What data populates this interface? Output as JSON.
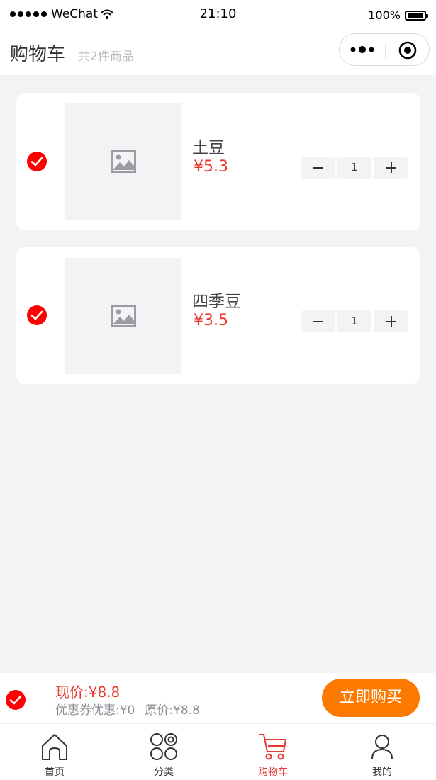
{
  "status_bar": {
    "carrier": "WeChat",
    "time": "21:10",
    "battery": "100%"
  },
  "header": {
    "title": "购物车",
    "subtitle": "共2件商品"
  },
  "capsule": {
    "more_icon": "more-dots-icon",
    "close_icon": "target-icon"
  },
  "items": [
    {
      "name": "土豆",
      "price": "¥5.3",
      "quantity": "1",
      "checked": true
    },
    {
      "name": "四季豆",
      "price": "¥3.5",
      "quantity": "1",
      "checked": true
    }
  ],
  "checkout": {
    "now_price": "现价:¥8.8",
    "coupon": "优惠券优惠:¥0",
    "original": "原价:¥8.8",
    "buy_label": "立即购买"
  },
  "tabbar": [
    {
      "label": "首页",
      "icon": "home-icon",
      "active": false
    },
    {
      "label": "分类",
      "icon": "category-icon",
      "active": false
    },
    {
      "label": "购物车",
      "icon": "cart-icon",
      "active": true
    },
    {
      "label": "我的",
      "icon": "user-icon",
      "active": false
    }
  ],
  "colors": {
    "accent": "#e83a30",
    "check": "#ff0000",
    "buy_button": "#fd7a00",
    "background": "#f2f3f5"
  }
}
